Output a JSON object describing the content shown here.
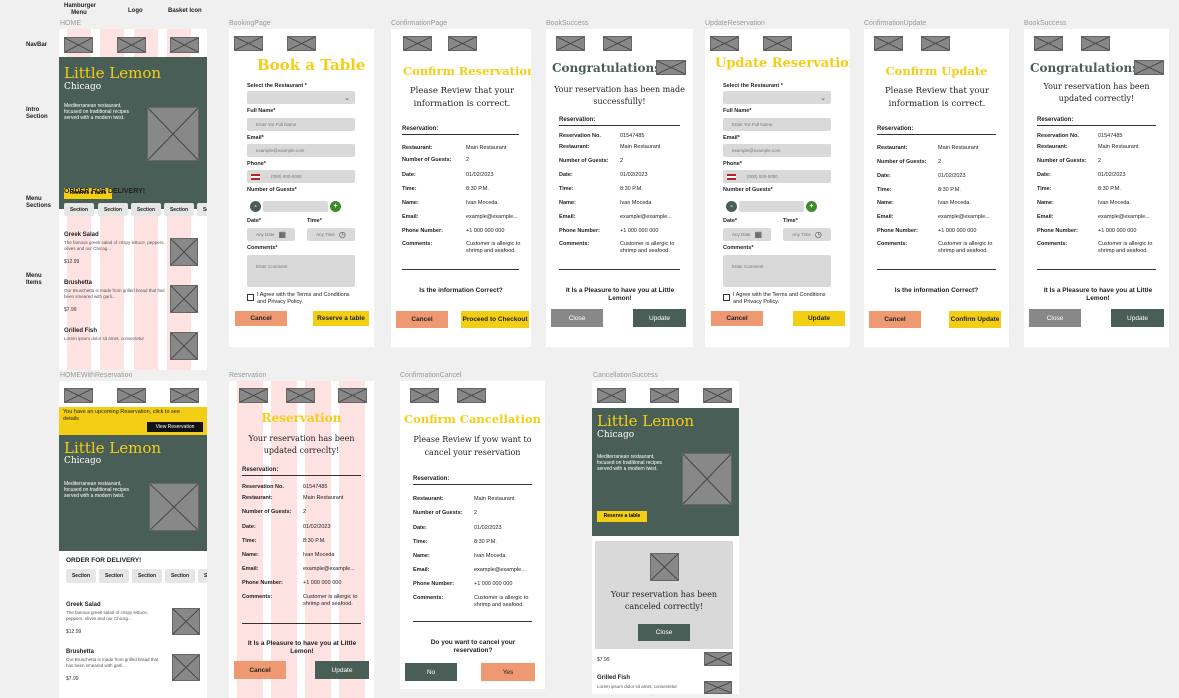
{
  "annotations": {
    "hamburger": "Hamburger Menu",
    "logo": "Logo",
    "basket": "Basket Icon",
    "navbar": "NavBar",
    "intro": "Intro Section",
    "menu_sections": "Menu Sections",
    "menu_items": "Menu Items"
  },
  "frame_labels": {
    "home": "HOME",
    "booking": "BookingPage",
    "confirmation": "ConfirmationPage",
    "book_success": "BookSuccess",
    "update_reservation": "UpdateReservation",
    "confirmation_update": "ConfirmationUpdate",
    "book_success2": "BookSuccess",
    "home_with_res": "HOMEWithReservation",
    "reservation": "Reservation",
    "confirmation_cancel": "ConfirmationCancel",
    "cancellation_success": "CancellationSuccess"
  },
  "hero": {
    "title": "Little Lemon",
    "city": "Chicago",
    "desc": "Mediterranean restaurant, focused on traditional recipes served with a modern twist.",
    "cta": "Reserve a table"
  },
  "menu": {
    "order_title": "ORDER FOR DELIVERY!",
    "section_label": "Section",
    "items": [
      {
        "name": "Greek Salad",
        "desc": "The famous greek salad of crispy lettuce, peppers, olives and our Chicag...",
        "price": "$12.99"
      },
      {
        "name": "Brushetta",
        "desc": "Our Bruschetta is made from grilled bread that has been smeared with garli...",
        "price": "$7.99"
      },
      {
        "name": "Grilled Fish",
        "desc": "Lorem ipsum dolor sit amet, consectetur",
        "price": ""
      }
    ]
  },
  "form": {
    "title_book": "Book a Table",
    "title_update": "Update Reservation",
    "select_label": "Select the Restaurant *",
    "name_label": "Full Name*",
    "name_ph": "Enter Yor Full Name",
    "email_label": "Email*",
    "email_ph": "example@example.com",
    "phone_label": "Phone*",
    "phone_ph": "(000) 000-0000",
    "guests_label": "Number of Guests*",
    "minus": "-",
    "plus": "+",
    "date_label": "Date*",
    "date_ph": "Any Date",
    "time_label": "Time*",
    "time_ph": "Any Time",
    "comments_label": "Comments*",
    "comments_ph": "Enter Comment",
    "terms": "I Agree with the Terms and Conditions and Privacy Policy.",
    "cancel": "Cancel",
    "reserve": "Reserve a table",
    "update": "Update"
  },
  "confirm": {
    "title": "Confirm Reservation",
    "title_update": "Confirm Update",
    "review": "Please Review that your information is correct.",
    "section": "Reservation:",
    "question": "Is the information Correct?",
    "cancel": "Cancel",
    "checkout": "Proceed to Checkout",
    "confirm_update": "Confirm Update"
  },
  "success": {
    "congrats": "Congratulations!",
    "made": "Your reservation has been made successfully!",
    "updated": "Your reservation has been updated correctly!",
    "updated_typo": "Your reservation has been updated correclty!",
    "pleasure": "It Is a Pleasure to have you at Little Lemon!",
    "close": "Close",
    "update": "Update",
    "cancel": "Cancel"
  },
  "res": {
    "k_no": "Reservation No.",
    "v_no": "01547485",
    "k_rest": "Restaurant:",
    "v_rest": "Main Restaurant",
    "k_guests": "Number of Guests:",
    "v_guests": "2",
    "k_date": "Date:",
    "v_date": "01/02/2023",
    "k_time": "Time:",
    "v_time": "8:30 P.M.",
    "k_name": "Name:",
    "v_name": "Ivan Moceda",
    "k_email": "Email:",
    "v_email": "example@example...",
    "k_phone": "Phone Number:",
    "v_phone": "+1 000 000 000",
    "k_comments": "Comments:",
    "v_comments": "Customer is allergic to shrimp and seafood."
  },
  "banner": {
    "text": "You have an upcoming Reservation, click to see details",
    "button": "View Reservation"
  },
  "reservation_page": {
    "title": "Reservation"
  },
  "cancel_page": {
    "title": "Confirm Cancellation",
    "review": "Please Review if yow want to cancel your reservation",
    "question": "Do you want to cancel your reservation?",
    "no": "No",
    "yes": "Yes"
  },
  "cancel_success": {
    "message": "Your reservation has been canceled correctly!",
    "close": "Close",
    "price": "$7.99",
    "fish": "Grilled Fish",
    "fish_desc": "Lorem ipsum dolor sit amet, consectetur"
  },
  "colors": {
    "green": "#495e57",
    "yellow": "#f4ce14",
    "salmon": "#ee9972",
    "grey": "#888888"
  }
}
